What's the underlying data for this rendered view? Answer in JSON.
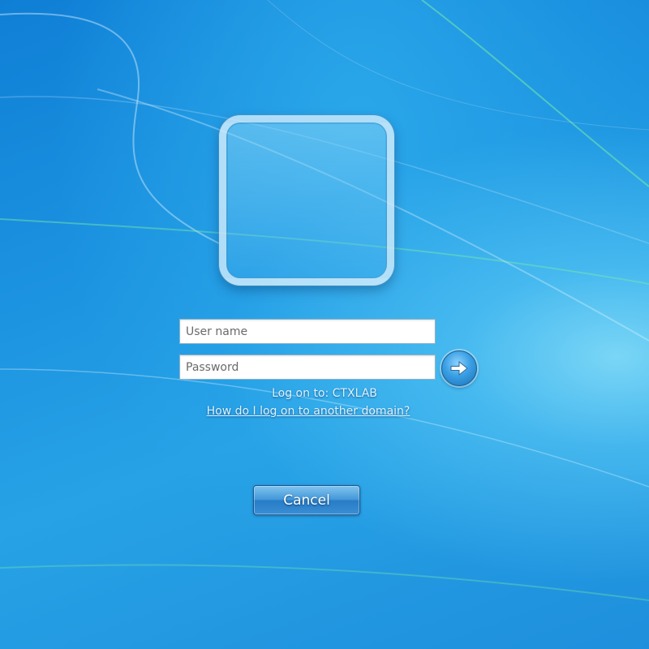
{
  "login": {
    "username_placeholder": "User name",
    "password_placeholder": "Password",
    "logon_to": "Log on to: CTXLAB",
    "other_domain_link": "How do I log on to another domain?",
    "cancel_label": "Cancel"
  },
  "icons": {
    "user_tile": "user-tile-frame",
    "submit": "arrow-right-icon"
  },
  "colors": {
    "background": "#1c93e0",
    "field_border": "#8ab2c9",
    "link_text": "#ddf2ff"
  }
}
